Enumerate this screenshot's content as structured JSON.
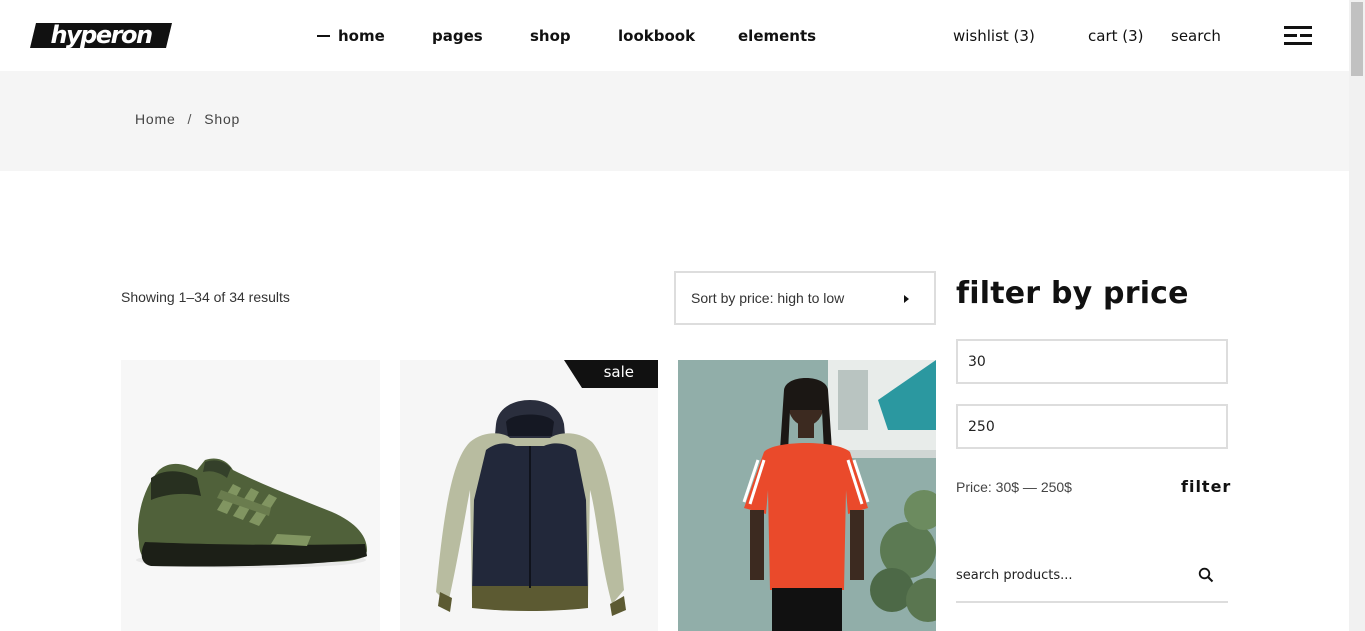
{
  "header": {
    "logo": "hyperon",
    "nav": [
      "home",
      "pages",
      "shop",
      "lookbook",
      "elements"
    ],
    "wishlist": "wishlist (3)",
    "cart": "cart (3)",
    "search": "search",
    "menu_icon": "hamburger-icon"
  },
  "breadcrumb": {
    "home": "Home",
    "separator": "/",
    "current": "Shop"
  },
  "results": {
    "text": "Showing 1–34 of 34 results",
    "sort_label": "Sort by price: high to low"
  },
  "products": [
    {
      "image": "green sneaker",
      "badge": ""
    },
    {
      "image": "navy and olive hooded jacket",
      "badge": "sale"
    },
    {
      "image": "man in orange t-shirt",
      "badge": ""
    }
  ],
  "sidebar": {
    "filter_title": "filter by price",
    "min_price": "30",
    "max_price": "250",
    "price_range": "Price: 30$ — 250$",
    "filter_button": "filter",
    "search_placeholder": "search products..."
  },
  "colors": {
    "accent": "#111111",
    "band": "#f5f5f5",
    "border": "#dddddd"
  }
}
